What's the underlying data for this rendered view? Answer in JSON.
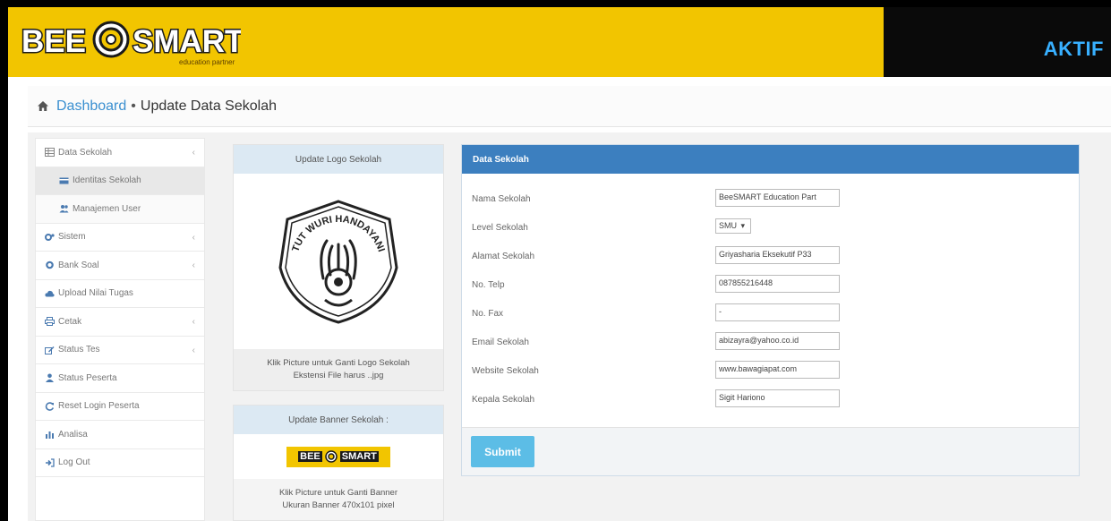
{
  "header": {
    "brand_main_left": "BEE",
    "brand_main_right": "SMART",
    "brand_tagline": "education partner",
    "status": "AKTIF"
  },
  "breadcrumb": {
    "home": "Dashboard",
    "separator": "•",
    "current": "Update Data Sekolah"
  },
  "sidebar": {
    "items": [
      {
        "label": "Data Sekolah",
        "icon": "table-icon",
        "chevron": "‹"
      },
      {
        "label": "Identitas Sekolah",
        "icon": "card-icon"
      },
      {
        "label": "Manajemen User",
        "icon": "users-icon"
      },
      {
        "label": "Sistem",
        "icon": "cogs-icon",
        "chevron": "‹"
      },
      {
        "label": "Bank Soal",
        "icon": "gear-icon",
        "chevron": "‹"
      },
      {
        "label": "Upload Nilai Tugas",
        "icon": "cloud-upload-icon"
      },
      {
        "label": "Cetak",
        "icon": "print-icon",
        "chevron": "‹"
      },
      {
        "label": "Status Tes",
        "icon": "edit-icon",
        "chevron": "‹"
      },
      {
        "label": "Status Peserta",
        "icon": "user-icon"
      },
      {
        "label": "Reset Login Peserta",
        "icon": "refresh-icon"
      },
      {
        "label": "Analisa",
        "icon": "bar-chart-icon"
      },
      {
        "label": "Log Out",
        "icon": "sign-out-icon"
      }
    ]
  },
  "logo_panel": {
    "title": "Update Logo Sekolah",
    "emblem_text": "TUT WURI HANDAYANI",
    "note_line1": "Klik Picture untuk Ganti Logo Sekolah",
    "note_line2": "Ekstensi File harus ..jpg"
  },
  "banner_panel": {
    "title": "Update Banner Sekolah :",
    "banner_text_left": "BEE",
    "banner_text_right": "SMART",
    "note_line1": "Klik Picture untuk Ganti Banner",
    "note_line2": "Ukuran Banner 470x101 pixel"
  },
  "form": {
    "title": "Data Sekolah",
    "fields": [
      {
        "label": "Nama Sekolah",
        "value": "BeeSMART Education Part"
      },
      {
        "label": "Level Sekolah",
        "value": "SMU"
      },
      {
        "label": "Alamat Sekolah",
        "value": "Griyasharia Eksekutif P33"
      },
      {
        "label": "No. Telp",
        "value": "087855216448"
      },
      {
        "label": "No. Fax",
        "value": "-"
      },
      {
        "label": "Email Sekolah",
        "value": "abizayra@yahoo.co.id"
      },
      {
        "label": "Website Sekolah",
        "value": "www.bawagiapat.com"
      },
      {
        "label": "Kepala Sekolah",
        "value": "Sigit Hariono"
      }
    ],
    "select_arrow": "▾",
    "submit_label": "Submit"
  },
  "colors": {
    "brand_yellow": "#f2c500",
    "status_blue": "#38b0ff",
    "form_header": "#3c7fbf",
    "submit": "#5cbde6",
    "link": "#3a8fd0"
  }
}
